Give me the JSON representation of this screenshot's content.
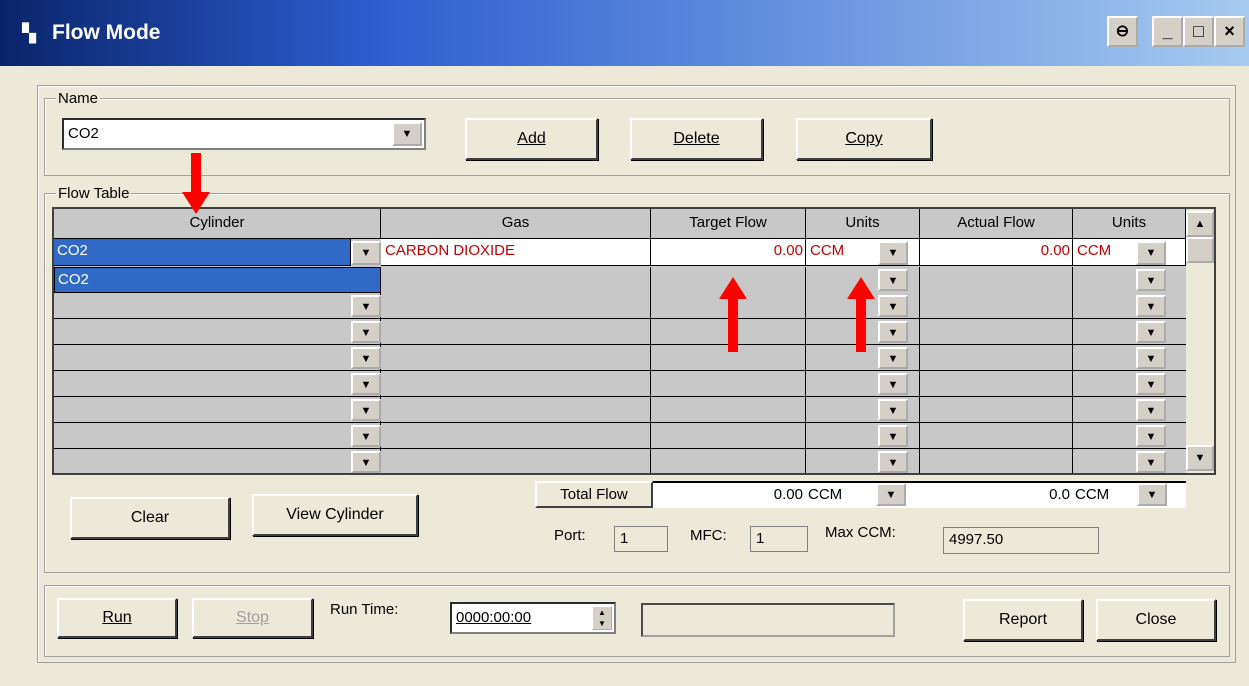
{
  "window": {
    "title": "Flow Mode",
    "controls": [
      "⊖",
      "_",
      "□",
      "×"
    ]
  },
  "name_group": {
    "label": "Name",
    "value": "CO2",
    "add": "Add",
    "delete": "Delete",
    "copy": "Copy"
  },
  "flow_table": {
    "label": "Flow Table",
    "headers": [
      "Cylinder",
      "Gas",
      "Target Flow",
      "Units",
      "Actual Flow",
      "Units"
    ],
    "rows": [
      {
        "cylinder": "CO2",
        "gas": "CARBON DIOXIDE",
        "target": "0.00",
        "units": "CCM",
        "actual": "0.00",
        "units2": "CCM"
      }
    ],
    "dropdown_option": "CO2",
    "total_flow_label": "Total Flow",
    "total_flow": "0.00",
    "total_units": "CCM",
    "total_actual": "0.0",
    "total_actual_units": "CCM"
  },
  "buttons": {
    "clear": "Clear",
    "view_cylinder": "View Cylinder",
    "run": "Run",
    "stop": "Stop",
    "report": "Report",
    "close": "Close"
  },
  "info": {
    "port_label": "Port:",
    "port": "1",
    "mfc_label": "MFC:",
    "mfc": "1",
    "max_label": "Max CCM:",
    "max": "4997.50"
  },
  "run_time": {
    "label": "Run Time:",
    "value": "0000:00:00"
  },
  "colors": {
    "title_start": "#0a246a",
    "selection": "#3169c6",
    "gas_text": "#c00000",
    "annotation": "#ff0000"
  }
}
